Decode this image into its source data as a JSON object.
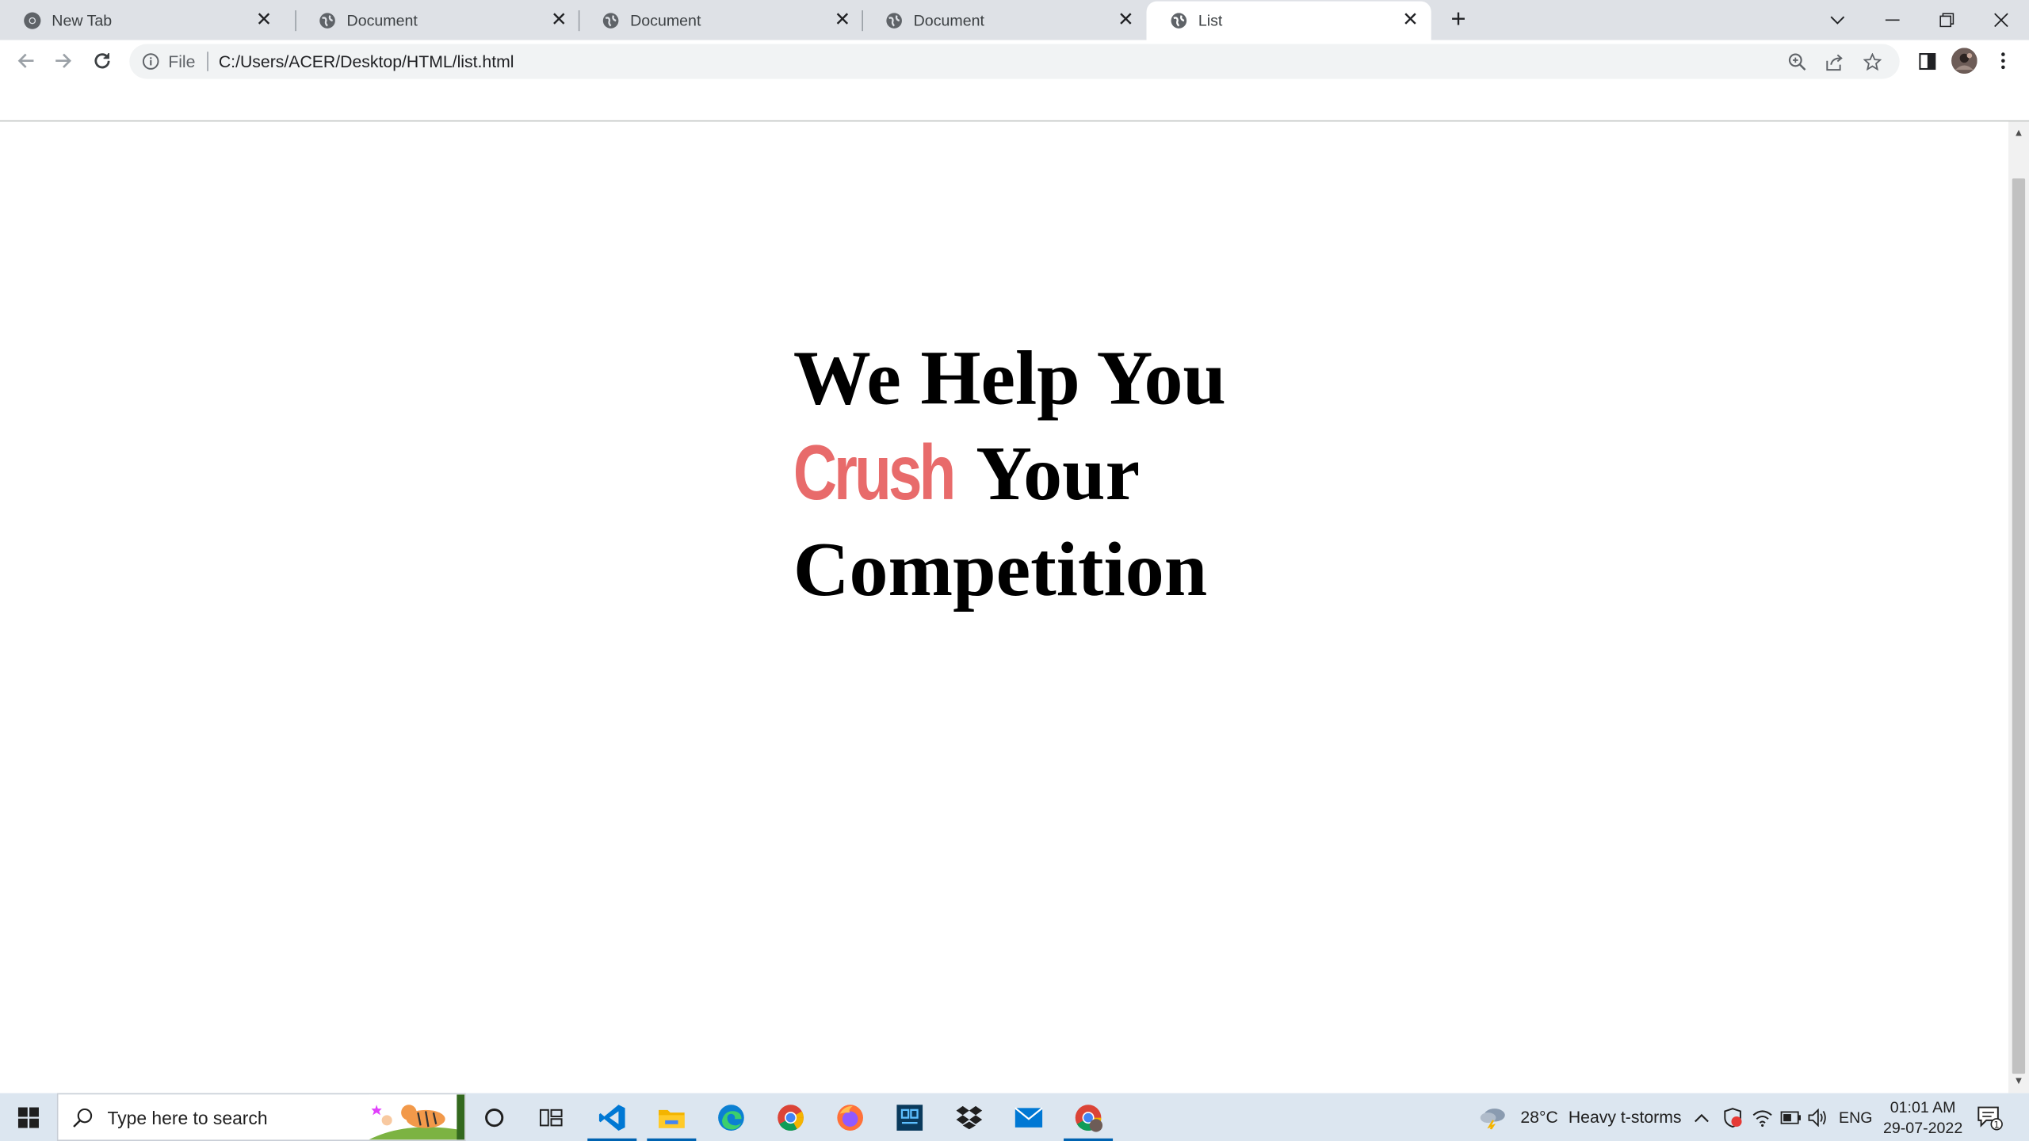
{
  "browser": {
    "tabs": [
      {
        "label": "New Tab",
        "icon": "chrome-icon",
        "active": false
      },
      {
        "label": "Document",
        "icon": "globe-icon",
        "active": false
      },
      {
        "label": "Document",
        "icon": "globe-icon",
        "active": false
      },
      {
        "label": "Document",
        "icon": "globe-icon",
        "active": false
      },
      {
        "label": "List",
        "icon": "globe-icon",
        "active": true
      }
    ],
    "address": {
      "scheme": "File",
      "url": "C:/Users/ACER/Desktop/HTML/list.html"
    }
  },
  "page": {
    "heading_line1": "We Help You",
    "heading_crush": "Crush",
    "heading_your": " Your",
    "heading_line3": "Competition",
    "accent_color": "#e86b6b"
  },
  "taskbar": {
    "search_placeholder": "Type here to search",
    "weather_temp": "28°C",
    "weather_desc": "Heavy t-storms",
    "language": "ENG",
    "time": "01:01 AM",
    "date": "29-07-2022",
    "notification_count": "1",
    "apps": [
      "cortana-icon",
      "task-view-icon",
      "vscode-icon",
      "file-explorer-icon",
      "edge-icon",
      "chrome-icon",
      "firefox-icon",
      "terminal-icon",
      "dropbox-icon",
      "mail-icon",
      "chrome-profile-icon"
    ]
  }
}
